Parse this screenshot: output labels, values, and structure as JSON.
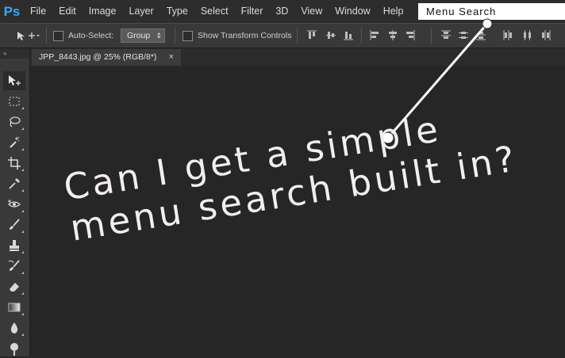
{
  "app": {
    "logo": "Ps"
  },
  "menu": {
    "items": [
      "File",
      "Edit",
      "Image",
      "Layer",
      "Type",
      "Select",
      "Filter",
      "3D",
      "View",
      "Window",
      "Help"
    ],
    "search_placeholder": "Menu Search"
  },
  "options": {
    "auto_select_label": "Auto-Select:",
    "auto_select_value": "Group",
    "show_transform_label": "Show Transform Controls"
  },
  "document": {
    "tab_title": "JPP_8443.jpg @ 25% (RGB/8*)",
    "close_glyph": "×"
  },
  "toolbox": {
    "tools": [
      "move-tool",
      "marquee-tool",
      "lasso-tool",
      "magic-wand-tool",
      "crop-tool",
      "eyedropper-tool",
      "spot-healing-tool",
      "brush-tool",
      "clone-stamp-tool",
      "history-brush-tool",
      "eraser-tool",
      "gradient-tool",
      "blur-tool",
      "dodge-tool"
    ]
  },
  "canvas": {
    "headline": "Can I get a simple\nmenu search built in?"
  },
  "colors": {
    "accent": "#31a8ff",
    "canvas": "#262626",
    "text": "#f2eef0"
  }
}
